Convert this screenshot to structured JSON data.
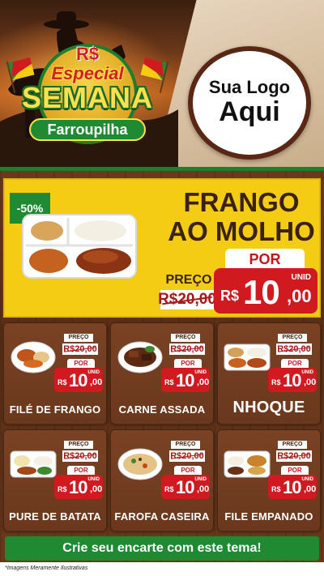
{
  "header": {
    "badge_rs": "R$",
    "badge_especial": "Especial",
    "badge_semana": "SEMANA",
    "badge_farroupilha": "Farroupilha",
    "logo_line1": "Sua Logo",
    "logo_line2": "Aqui"
  },
  "featured": {
    "discount": "-50%",
    "title_line1": "FRANGO",
    "title_line2": "AO MOLHO",
    "preco_label": "PREÇO",
    "old_price": "R$20,00",
    "por_label": "POR",
    "unid_label": "UNID",
    "currency": "R$",
    "new_price_int": "10",
    "new_price_cents": ",00"
  },
  "card_labels": {
    "preco": "PREÇO",
    "por": "POR",
    "unid": "UNID",
    "currency": "R$",
    "old_price": "R$20,00",
    "new_price_int": "10",
    "new_price_cents": ",00"
  },
  "products": [
    {
      "name": "FILÉ DE FRANGO",
      "icon": "bowl-chicken-icon"
    },
    {
      "name": "CARNE ASSADA",
      "icon": "bowl-beef-icon"
    },
    {
      "name": "NHOQUE",
      "icon": "tray-pasta-icon"
    },
    {
      "name": "PURE DE BATATA",
      "icon": "tray-puree-icon"
    },
    {
      "name": "FAROFA CASEIRA",
      "icon": "bowl-farofa-icon"
    },
    {
      "name": "FILE EMPANADO",
      "icon": "tray-breaded-icon"
    }
  ],
  "footer": {
    "cta": "Crie seu encarte com este tema!",
    "disclaimer": "*Imagens Meramente Ilustrativas"
  },
  "colors": {
    "green": "#1f8a32",
    "yellow": "#f5cc14",
    "red": "#d11a1f",
    "wood": "#6b3a1c"
  }
}
